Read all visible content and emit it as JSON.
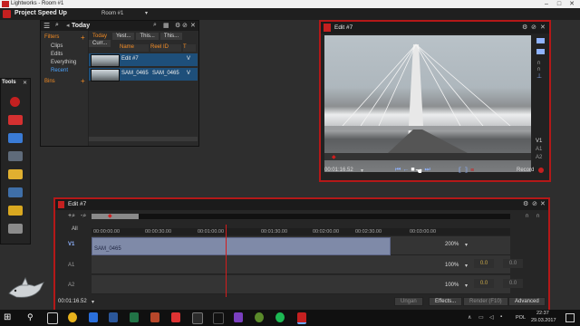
{
  "window": {
    "title": "Lightworks - Room #1",
    "controls": [
      "–",
      "□",
      "✕"
    ]
  },
  "menubar": {
    "project": "Project Speed Up",
    "room": "Room #1"
  },
  "browser": {
    "title": "Today",
    "sidebar": {
      "filters_label": "Filters",
      "items": [
        "Clips",
        "Edits",
        "Everything",
        "Recent"
      ],
      "bins_label": "Bins"
    },
    "tabs": [
      "Today",
      "Yest...",
      "This...",
      "This...",
      "Curr..."
    ],
    "columns": [
      "Name",
      "Reel ID",
      "T"
    ],
    "rows": [
      {
        "name": "Edit #7",
        "reel": "",
        "t": "V"
      },
      {
        "name": "SAM_0465",
        "reel": "SAM_0465",
        "t": "V"
      }
    ]
  },
  "tools": {
    "title": "Tools",
    "items": [
      "record-icon",
      "import-icon",
      "calendar-icon",
      "keyboard-icon",
      "folder-icon",
      "grid-icon",
      "export-icon",
      "users-icon"
    ]
  },
  "viewer": {
    "title": "Edit #7",
    "timecode": "00:01:16.52",
    "tracks": [
      "V1",
      "A1",
      "A2"
    ],
    "record_label": "Record"
  },
  "timeline": {
    "title": "Edit #7",
    "timecode": "00:01:16.52",
    "ruler_ticks": [
      "00:00:00.00",
      "00:00:30.00",
      "00:01:00.00",
      "00:01:30.00",
      "00:02:00.00",
      "00:02:30.00",
      "00:03:00.00"
    ],
    "all_label": "All",
    "tracks": [
      {
        "label": "V1",
        "zoom": "200%",
        "clip": "SAM_0465"
      },
      {
        "label": "A1",
        "zoom": "100%",
        "gain": "0.0"
      },
      {
        "label": "A2",
        "zoom": "100%",
        "gain": "0.0"
      }
    ],
    "buttons": [
      "Ungan",
      "Effects...",
      "Render (F10)",
      "Advanced"
    ]
  },
  "taskbar": {
    "language": "POL",
    "time": "22:37",
    "date": "29.03.2017"
  }
}
